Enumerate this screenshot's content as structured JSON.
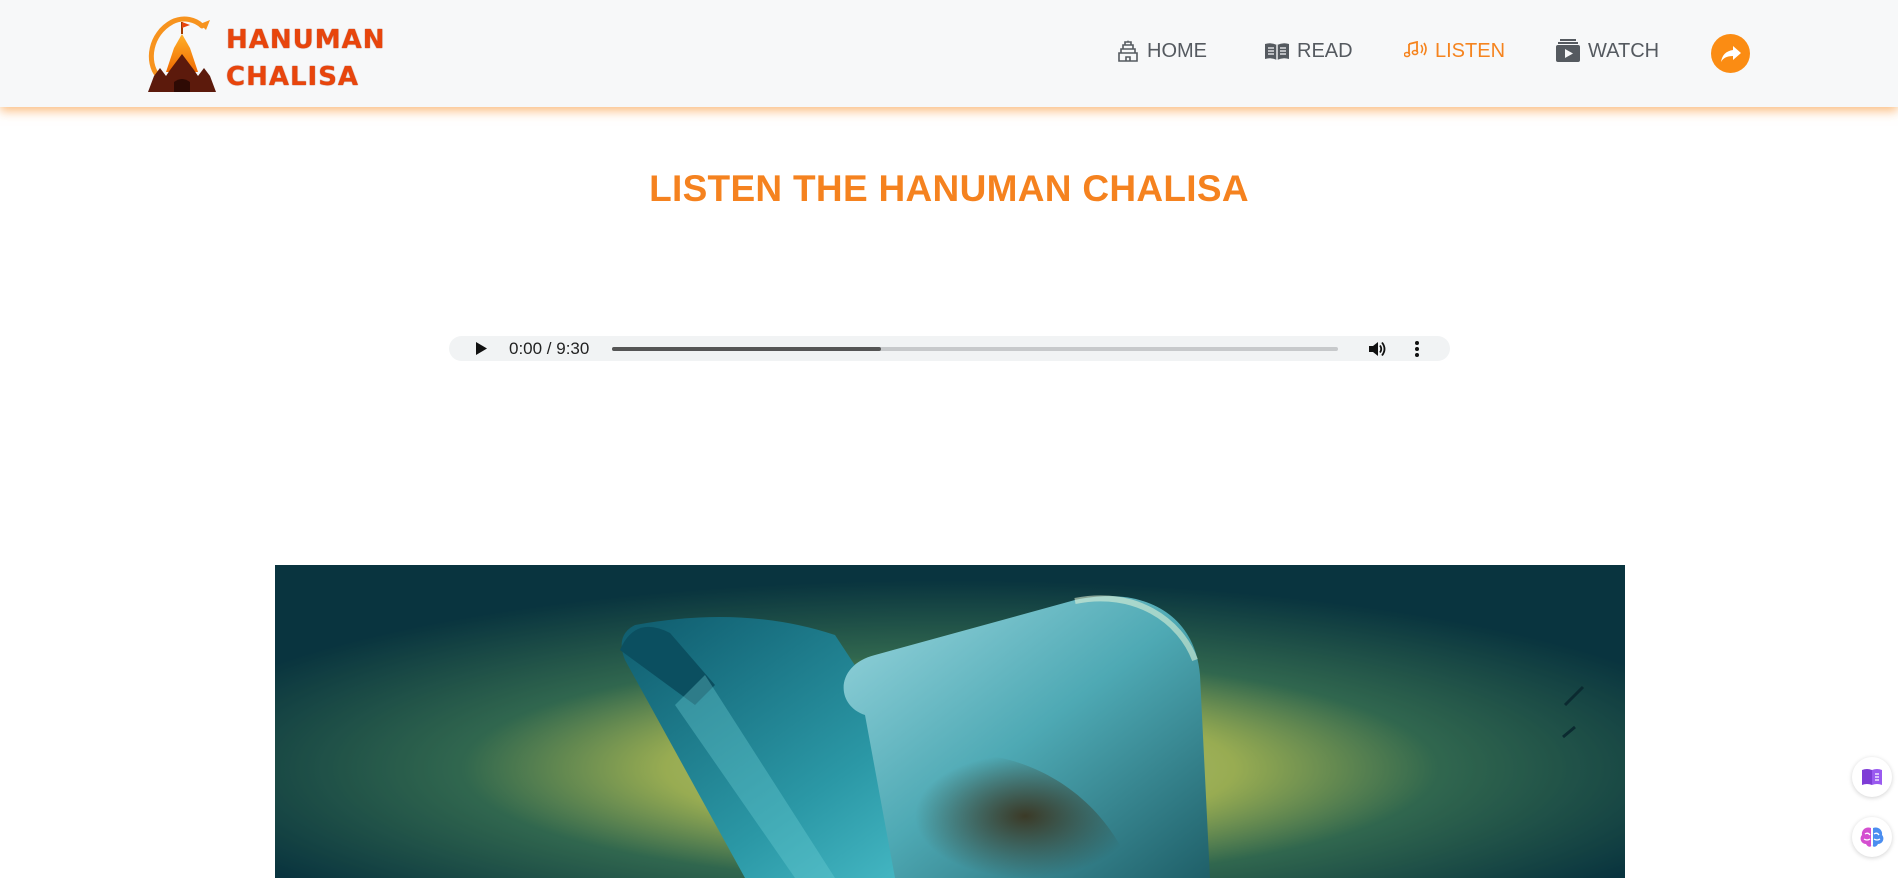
{
  "site": {
    "logo_line1": "HANUMAN",
    "logo_line2": "CHALISA",
    "brand_color": "#f5821f",
    "logo_text_color": "#e8450c"
  },
  "nav": {
    "items": [
      {
        "label": "HOME",
        "icon": "temple-icon",
        "active": false
      },
      {
        "label": "READ",
        "icon": "book-icon",
        "active": false
      },
      {
        "label": "LISTEN",
        "icon": "music-notes-icon",
        "active": true
      },
      {
        "label": "WATCH",
        "icon": "video-icon",
        "active": false
      }
    ],
    "share_icon": "share-arrow-icon",
    "active_color": "#f5841f",
    "text_color": "#555a60"
  },
  "page": {
    "title": "LISTEN THE HANUMAN CHALISA"
  },
  "audio": {
    "time_display": "0:00 / 9:30",
    "buffered_fraction": 0.37,
    "play_icon": "play-icon",
    "volume_icon": "volume-icon",
    "menu_icon": "more-vertical-icon"
  },
  "hero": {
    "image": "shivling-illustration"
  },
  "floating_buttons": [
    {
      "icon": "reader-icon"
    },
    {
      "icon": "brain-icon"
    }
  ]
}
